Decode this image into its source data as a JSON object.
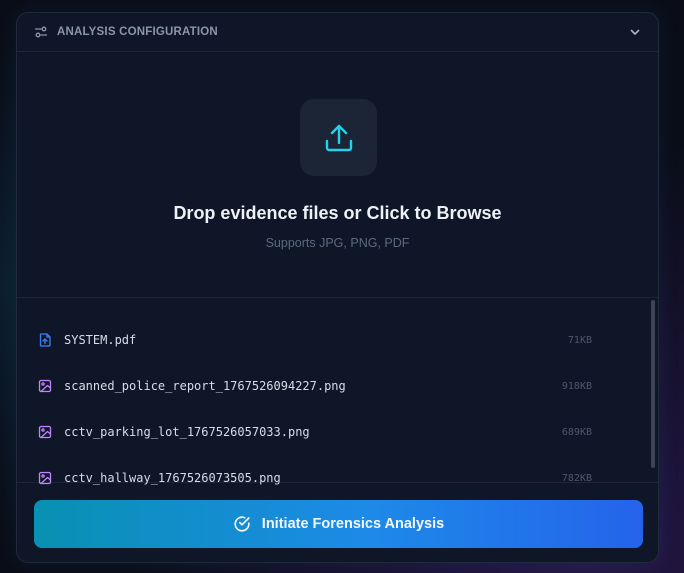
{
  "header": {
    "title": "ANALYSIS CONFIGURATION",
    "left_icon": "sliders-icon",
    "right_icon": "chevron-down-icon"
  },
  "dropzone": {
    "icon": "upload-icon",
    "title": "Drop evidence files or Click to Browse",
    "subtitle": "Supports JPG, PNG, PDF"
  },
  "files": [
    {
      "name": "SYSTEM.pdf",
      "size": "71KB",
      "icon": "file-pdf-icon"
    },
    {
      "name": "scanned_police_report_1767526094227.png",
      "size": "918KB",
      "icon": "image-icon"
    },
    {
      "name": "cctv_parking_lot_1767526057033.png",
      "size": "689KB",
      "icon": "image-icon"
    },
    {
      "name": "cctv_hallway_1767526073505.png",
      "size": "782KB",
      "icon": "image-icon"
    }
  ],
  "action": {
    "label": "Initiate Forensics Analysis",
    "icon": "check-circle-icon"
  },
  "colors": {
    "accent_cyan": "#22d3ee",
    "pdf_icon": "#3b82f6",
    "image_icon": "#c084fc",
    "button_gradient_start": "#0891b2",
    "button_gradient_end": "#2563eb"
  }
}
